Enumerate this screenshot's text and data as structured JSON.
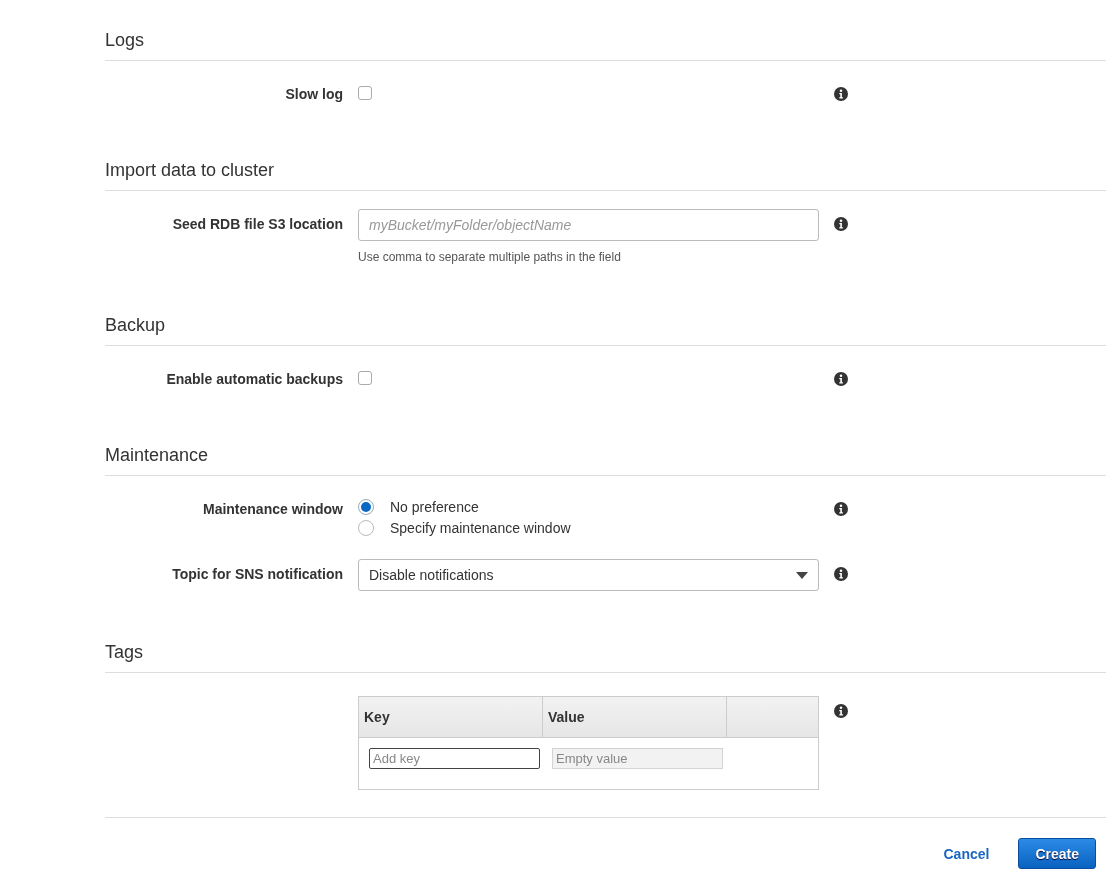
{
  "sections": [
    {
      "title": "Logs",
      "rows": [
        {
          "kind": "checkbox",
          "label": "Slow log",
          "checked": false
        }
      ]
    },
    {
      "title": "Import data to cluster",
      "rows": [
        {
          "kind": "text",
          "label": "Seed RDB file S3 location",
          "placeholder": "myBucket/myFolder/objectName",
          "hint": "Use comma to separate multiple paths in the field"
        }
      ]
    },
    {
      "title": "Backup",
      "rows": [
        {
          "kind": "checkbox",
          "label": "Enable automatic backups",
          "checked": false
        }
      ]
    },
    {
      "title": "Maintenance",
      "rows": [
        {
          "kind": "radio",
          "label": "Maintenance window",
          "options": [
            {
              "label": "No preference",
              "selected": true
            },
            {
              "label": "Specify maintenance window",
              "selected": false
            }
          ]
        },
        {
          "kind": "select",
          "label": "Topic for SNS notification",
          "value": "Disable notifications"
        }
      ]
    },
    {
      "title": "Tags",
      "rows": [
        {
          "kind": "tags",
          "columns": [
            "Key",
            "Value"
          ],
          "key_field": {
            "placeholder": "Add key",
            "focused": true
          },
          "value_field": {
            "placeholder": "Empty value",
            "disabled": true
          }
        }
      ]
    }
  ],
  "buttons": [
    {
      "label": "Cancel",
      "kind": "link"
    },
    {
      "label": "Create",
      "kind": "primary"
    }
  ]
}
